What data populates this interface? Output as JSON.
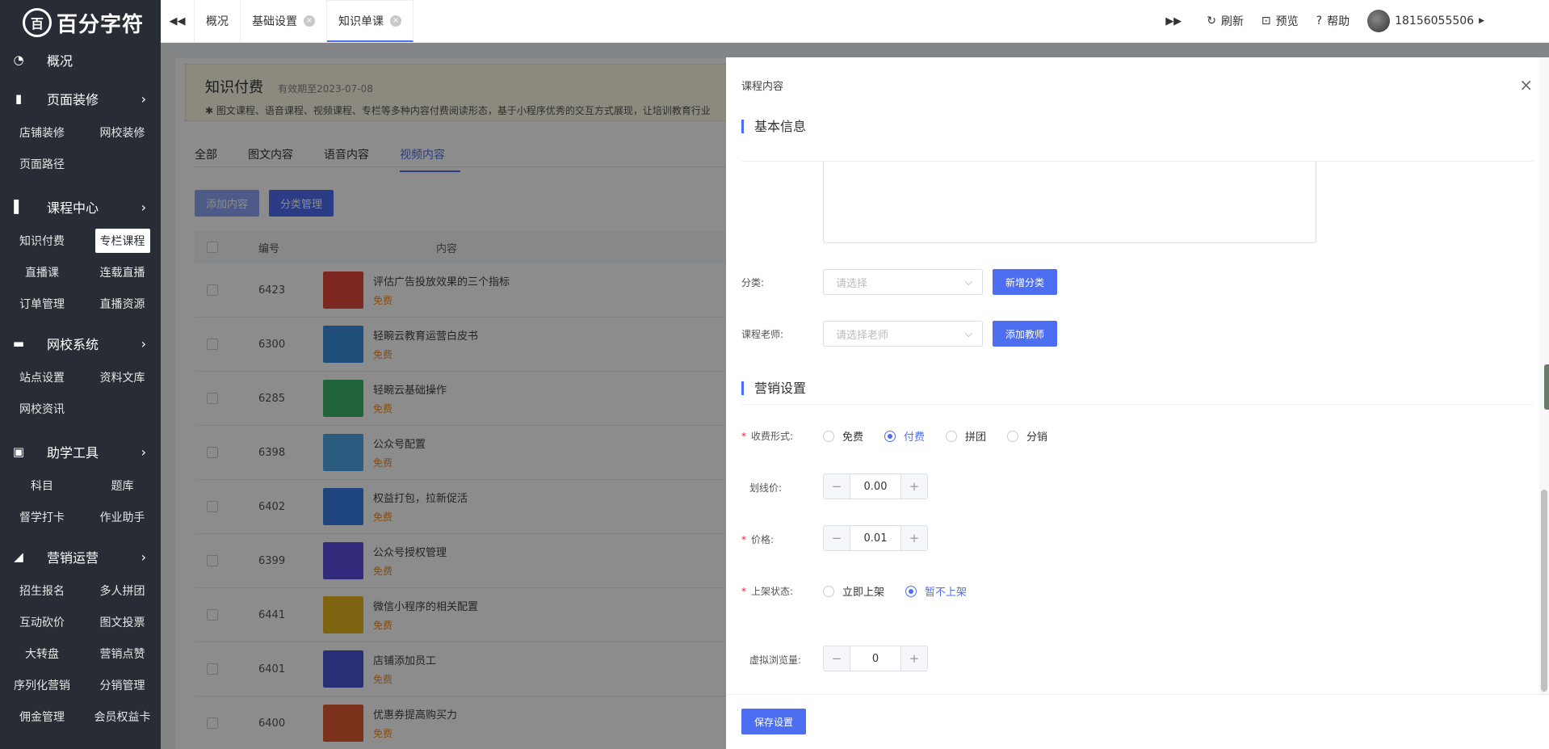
{
  "brand": {
    "logo_mark": "百",
    "logo_text": "百分字符"
  },
  "sidebar": {
    "sections": [
      {
        "label": "概况",
        "icon": "pie-chart-icon",
        "items": []
      },
      {
        "label": "页面装修",
        "icon": "brush-icon",
        "items": [
          "店铺装修",
          "网校装修",
          "页面路径"
        ]
      },
      {
        "label": "课程中心",
        "icon": "book-icon",
        "items": [
          "知识付费",
          "专栏课程",
          "直播课",
          "连载直播",
          "订单管理",
          "直播资源"
        ]
      },
      {
        "label": "网校系统",
        "icon": "monitor-icon",
        "items": [
          "站点设置",
          "资料文库",
          "网校资讯"
        ]
      },
      {
        "label": "助学工具",
        "icon": "toolbox-icon",
        "items": [
          "科目",
          "题库",
          "督学打卡",
          "作业助手"
        ]
      },
      {
        "label": "营销运营",
        "icon": "megaphone-icon",
        "items": [
          "招生报名",
          "多人拼团",
          "互动砍价",
          "图文投票",
          "大转盘",
          "营销点赞",
          "序列化营销",
          "分销管理",
          "佣金管理",
          "会员权益卡"
        ]
      }
    ],
    "active_item": "专栏课程"
  },
  "topbar": {
    "tabs": [
      "概况",
      "基础设置",
      "知识单课"
    ],
    "active_tab": "知识单课",
    "actions": {
      "refresh": "刷新",
      "preview": "预览",
      "help": "帮助"
    },
    "user_phone": "18156055506"
  },
  "background": {
    "notice_title": "知识付费",
    "notice_expiry": "有效期至2023-07-08",
    "notice_desc": "图文课程、语音课程、视频课程、专栏等多种内容付费阅读形态，基于小程序优秀的交互方式展现，让培训教育行业",
    "content_tabs": [
      "全部",
      "图文内容",
      "语音内容",
      "视频内容"
    ],
    "active_content_tab": "视频内容",
    "add_button": "添加内容",
    "category_button": "分类管理",
    "table_headers": {
      "id": "编号",
      "content": "内容"
    },
    "rows": [
      {
        "id": "6423",
        "title": "评估广告投放效果的三个指标",
        "price": "免费",
        "color": "#e24a3b"
      },
      {
        "id": "6300",
        "title": "轻畹云教育运营白皮书",
        "price": "免费",
        "color": "#3a8fe0"
      },
      {
        "id": "6285",
        "title": "轻畹云基础操作",
        "price": "免费",
        "color": "#3cb56a"
      },
      {
        "id": "6398",
        "title": "公众号配置",
        "price": "免费",
        "color": "#4fa8e8"
      },
      {
        "id": "6402",
        "title": "权益打包，拉新促活",
        "price": "免费",
        "color": "#3a7fe8"
      },
      {
        "id": "6399",
        "title": "公众号授权管理",
        "price": "免费",
        "color": "#5b4de0"
      },
      {
        "id": "6441",
        "title": "微信小程序的相关配置",
        "price": "免费",
        "color": "#e8b820"
      },
      {
        "id": "6401",
        "title": "店铺添加员工",
        "price": "免费",
        "color": "#4a56d8"
      },
      {
        "id": "6400",
        "title": "优惠券提高购买力",
        "price": "免费",
        "color": "#e05a30"
      }
    ]
  },
  "drawer": {
    "title": "课程内容",
    "basic_section": "基本信息",
    "category_label": "分类:",
    "category_placeholder": "请选择",
    "add_category_button": "新增分类",
    "teacher_label": "课程老师:",
    "teacher_placeholder": "请选择老师",
    "add_teacher_button": "添加教师",
    "marketing_section": "营销设置",
    "charge_label": "收费形式:",
    "charge_options": [
      "免费",
      "付费",
      "拼团",
      "分销"
    ],
    "charge_selected": "付费",
    "original_price_label": "划线价:",
    "original_price_value": "0.00",
    "price_label": "价格:",
    "price_value": "0.01",
    "status_label": "上架状态:",
    "status_options": [
      "立即上架",
      "暂不上架"
    ],
    "status_selected": "暂不上架",
    "views_label": "虚拟浏览量:",
    "views_value": "0",
    "save_button": "保存设置",
    "required_mark": "*",
    "minus": "−",
    "plus": "+",
    "close": "×"
  },
  "colors": {
    "primary": "#4e6ef2",
    "sidebar_bg": "#282c34",
    "free_text": "#f28c28",
    "required": "#f5222d"
  }
}
